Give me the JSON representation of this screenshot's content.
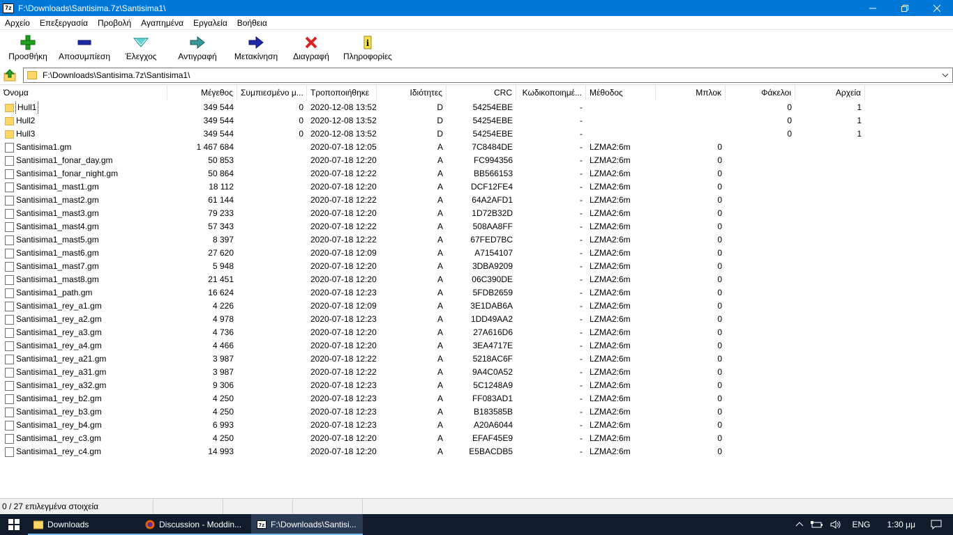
{
  "window": {
    "title": "F:\\Downloads\\Santisima.7z\\Santisima1\\",
    "app_icon_text": "7z"
  },
  "menu": [
    "Αρχείο",
    "Επεξεργασία",
    "Προβολή",
    "Αγαπημένα",
    "Εργαλεία",
    "Βοήθεια"
  ],
  "toolbar": {
    "add": "Προσθήκη",
    "extract": "Αποσυμπίεση",
    "test": "Έλεγχος",
    "copy": "Αντιγραφή",
    "move": "Μετακίνηση",
    "delete": "Διαγραφή",
    "info": "Πληροφορίες"
  },
  "address": {
    "path": "F:\\Downloads\\Santisima.7z\\Santisima1\\"
  },
  "columns": [
    "Όνομα",
    "Μέγεθος",
    "Συμπιεσμένο μ...",
    "Τροποποιήθηκε",
    "Ιδιότητες",
    "CRC",
    "Κωδικοποιημέ...",
    "Μέθοδος",
    "Μπλοκ",
    "Φάκελοι",
    "Αρχεία"
  ],
  "rows": [
    {
      "type": "folder",
      "name": "Hull1",
      "size": "349 544",
      "packed": "0",
      "modified": "2020-12-08 13:52",
      "attr": "D",
      "crc": "54254EBE",
      "enc": "-",
      "method": "",
      "block": "",
      "folders": "0",
      "files": "1"
    },
    {
      "type": "folder",
      "name": "Hull2",
      "size": "349 544",
      "packed": "0",
      "modified": "2020-12-08 13:52",
      "attr": "D",
      "crc": "54254EBE",
      "enc": "-",
      "method": "",
      "block": "",
      "folders": "0",
      "files": "1"
    },
    {
      "type": "folder",
      "name": "Hull3",
      "size": "349 544",
      "packed": "0",
      "modified": "2020-12-08 13:52",
      "attr": "D",
      "crc": "54254EBE",
      "enc": "-",
      "method": "",
      "block": "",
      "folders": "0",
      "files": "1"
    },
    {
      "type": "file",
      "name": "Santisima1.gm",
      "size": "1 467 684",
      "packed": "",
      "modified": "2020-07-18 12:05",
      "attr": "A",
      "crc": "7C8484DE",
      "enc": "-",
      "method": "LZMA2:6m",
      "block": "0",
      "folders": "",
      "files": ""
    },
    {
      "type": "file",
      "name": "Santisima1_fonar_day.gm",
      "size": "50 853",
      "packed": "",
      "modified": "2020-07-18 12:20",
      "attr": "A",
      "crc": "FC994356",
      "enc": "-",
      "method": "LZMA2:6m",
      "block": "0",
      "folders": "",
      "files": ""
    },
    {
      "type": "file",
      "name": "Santisima1_fonar_night.gm",
      "size": "50 864",
      "packed": "",
      "modified": "2020-07-18 12:22",
      "attr": "A",
      "crc": "BB566153",
      "enc": "-",
      "method": "LZMA2:6m",
      "block": "0",
      "folders": "",
      "files": ""
    },
    {
      "type": "file",
      "name": "Santisima1_mast1.gm",
      "size": "18 112",
      "packed": "",
      "modified": "2020-07-18 12:20",
      "attr": "A",
      "crc": "DCF12FE4",
      "enc": "-",
      "method": "LZMA2:6m",
      "block": "0",
      "folders": "",
      "files": ""
    },
    {
      "type": "file",
      "name": "Santisima1_mast2.gm",
      "size": "61 144",
      "packed": "",
      "modified": "2020-07-18 12:22",
      "attr": "A",
      "crc": "64A2AFD1",
      "enc": "-",
      "method": "LZMA2:6m",
      "block": "0",
      "folders": "",
      "files": ""
    },
    {
      "type": "file",
      "name": "Santisima1_mast3.gm",
      "size": "79 233",
      "packed": "",
      "modified": "2020-07-18 12:20",
      "attr": "A",
      "crc": "1D72B32D",
      "enc": "-",
      "method": "LZMA2:6m",
      "block": "0",
      "folders": "",
      "files": ""
    },
    {
      "type": "file",
      "name": "Santisima1_mast4.gm",
      "size": "57 343",
      "packed": "",
      "modified": "2020-07-18 12:22",
      "attr": "A",
      "crc": "508AA8FF",
      "enc": "-",
      "method": "LZMA2:6m",
      "block": "0",
      "folders": "",
      "files": ""
    },
    {
      "type": "file",
      "name": "Santisima1_mast5.gm",
      "size": "8 397",
      "packed": "",
      "modified": "2020-07-18 12:22",
      "attr": "A",
      "crc": "67FED7BC",
      "enc": "-",
      "method": "LZMA2:6m",
      "block": "0",
      "folders": "",
      "files": ""
    },
    {
      "type": "file",
      "name": "Santisima1_mast6.gm",
      "size": "27 620",
      "packed": "",
      "modified": "2020-07-18 12:09",
      "attr": "A",
      "crc": "A7154107",
      "enc": "-",
      "method": "LZMA2:6m",
      "block": "0",
      "folders": "",
      "files": ""
    },
    {
      "type": "file",
      "name": "Santisima1_mast7.gm",
      "size": "5 948",
      "packed": "",
      "modified": "2020-07-18 12:20",
      "attr": "A",
      "crc": "3DBA9209",
      "enc": "-",
      "method": "LZMA2:6m",
      "block": "0",
      "folders": "",
      "files": ""
    },
    {
      "type": "file",
      "name": "Santisima1_mast8.gm",
      "size": "21 451",
      "packed": "",
      "modified": "2020-07-18 12:20",
      "attr": "A",
      "crc": "06C390DE",
      "enc": "-",
      "method": "LZMA2:6m",
      "block": "0",
      "folders": "",
      "files": ""
    },
    {
      "type": "file",
      "name": "Santisima1_path.gm",
      "size": "16 624",
      "packed": "",
      "modified": "2020-07-18 12:23",
      "attr": "A",
      "crc": "5FDB2659",
      "enc": "-",
      "method": "LZMA2:6m",
      "block": "0",
      "folders": "",
      "files": ""
    },
    {
      "type": "file",
      "name": "Santisima1_rey_a1.gm",
      "size": "4 226",
      "packed": "",
      "modified": "2020-07-18 12:09",
      "attr": "A",
      "crc": "3E1DAB6A",
      "enc": "-",
      "method": "LZMA2:6m",
      "block": "0",
      "folders": "",
      "files": ""
    },
    {
      "type": "file",
      "name": "Santisima1_rey_a2.gm",
      "size": "4 978",
      "packed": "",
      "modified": "2020-07-18 12:23",
      "attr": "A",
      "crc": "1DD49AA2",
      "enc": "-",
      "method": "LZMA2:6m",
      "block": "0",
      "folders": "",
      "files": ""
    },
    {
      "type": "file",
      "name": "Santisima1_rey_a3.gm",
      "size": "4 736",
      "packed": "",
      "modified": "2020-07-18 12:20",
      "attr": "A",
      "crc": "27A616D6",
      "enc": "-",
      "method": "LZMA2:6m",
      "block": "0",
      "folders": "",
      "files": ""
    },
    {
      "type": "file",
      "name": "Santisima1_rey_a4.gm",
      "size": "4 466",
      "packed": "",
      "modified": "2020-07-18 12:20",
      "attr": "A",
      "crc": "3EA4717E",
      "enc": "-",
      "method": "LZMA2:6m",
      "block": "0",
      "folders": "",
      "files": ""
    },
    {
      "type": "file",
      "name": "Santisima1_rey_a21.gm",
      "size": "3 987",
      "packed": "",
      "modified": "2020-07-18 12:22",
      "attr": "A",
      "crc": "5218AC6F",
      "enc": "-",
      "method": "LZMA2:6m",
      "block": "0",
      "folders": "",
      "files": ""
    },
    {
      "type": "file",
      "name": "Santisima1_rey_a31.gm",
      "size": "3 987",
      "packed": "",
      "modified": "2020-07-18 12:22",
      "attr": "A",
      "crc": "9A4C0A52",
      "enc": "-",
      "method": "LZMA2:6m",
      "block": "0",
      "folders": "",
      "files": ""
    },
    {
      "type": "file",
      "name": "Santisima1_rey_a32.gm",
      "size": "9 306",
      "packed": "",
      "modified": "2020-07-18 12:23",
      "attr": "A",
      "crc": "5C1248A9",
      "enc": "-",
      "method": "LZMA2:6m",
      "block": "0",
      "folders": "",
      "files": ""
    },
    {
      "type": "file",
      "name": "Santisima1_rey_b2.gm",
      "size": "4 250",
      "packed": "",
      "modified": "2020-07-18 12:23",
      "attr": "A",
      "crc": "FF083AD1",
      "enc": "-",
      "method": "LZMA2:6m",
      "block": "0",
      "folders": "",
      "files": ""
    },
    {
      "type": "file",
      "name": "Santisima1_rey_b3.gm",
      "size": "4 250",
      "packed": "",
      "modified": "2020-07-18 12:23",
      "attr": "A",
      "crc": "B183585B",
      "enc": "-",
      "method": "LZMA2:6m",
      "block": "0",
      "folders": "",
      "files": ""
    },
    {
      "type": "file",
      "name": "Santisima1_rey_b4.gm",
      "size": "6 993",
      "packed": "",
      "modified": "2020-07-18 12:23",
      "attr": "A",
      "crc": "A20A6044",
      "enc": "-",
      "method": "LZMA2:6m",
      "block": "0",
      "folders": "",
      "files": ""
    },
    {
      "type": "file",
      "name": "Santisima1_rey_c3.gm",
      "size": "4 250",
      "packed": "",
      "modified": "2020-07-18 12:20",
      "attr": "A",
      "crc": "EFAF45E9",
      "enc": "-",
      "method": "LZMA2:6m",
      "block": "0",
      "folders": "",
      "files": ""
    },
    {
      "type": "file",
      "name": "Santisima1_rey_c4.gm",
      "size": "14 993",
      "packed": "",
      "modified": "2020-07-18 12:20",
      "attr": "A",
      "crc": "E5BACDB5",
      "enc": "-",
      "method": "LZMA2:6m",
      "block": "0",
      "folders": "",
      "files": ""
    }
  ],
  "status": {
    "selection": "0 / 27 επιλεγμένα στοιχεία"
  },
  "taskbar": {
    "tasks": [
      {
        "label": "Downloads",
        "icon": "folder-icon"
      },
      {
        "label": "Discussion - Moddin...",
        "icon": "firefox-icon"
      },
      {
        "label": "F:\\Downloads\\Santisi...",
        "icon": "7zip-icon"
      }
    ],
    "language": "ENG",
    "time": "1:30 μμ"
  },
  "colors": {
    "titlebar": "#0078d7",
    "taskbar": "#101c2c",
    "folder": "#ffd766"
  }
}
